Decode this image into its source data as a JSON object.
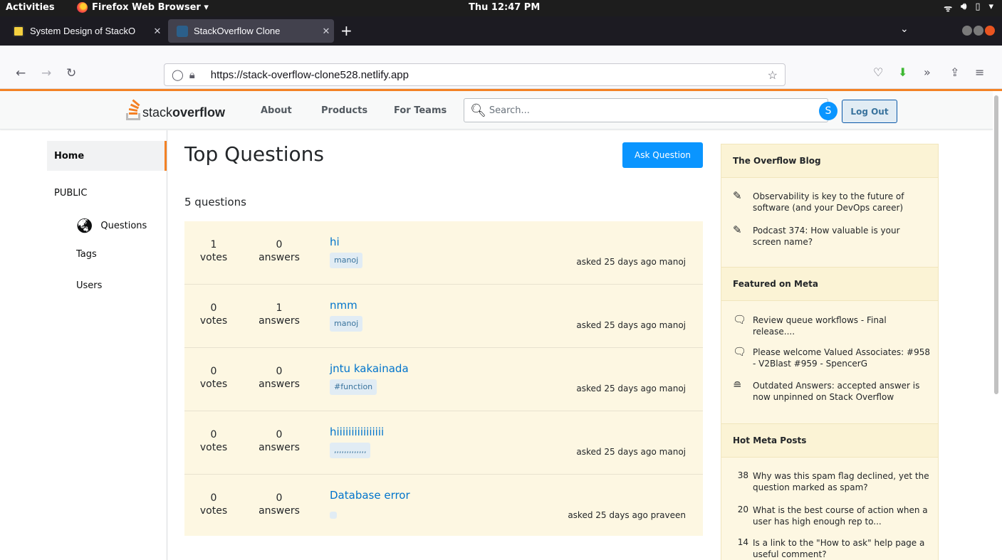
{
  "system": {
    "activities": "Activities",
    "app_menu": "Firefox Web Browser ▾",
    "clock": "Thu 12:47 PM"
  },
  "browser": {
    "tabs": [
      {
        "title": "System Design of StackO",
        "active": false
      },
      {
        "title": "StackOverflow Clone",
        "active": true
      }
    ],
    "url": "https://stack-overflow-clone528.netlify.app"
  },
  "site": {
    "logo_stack": "stack",
    "logo_overflow": "overflow",
    "nav": [
      "About",
      "Products",
      "For Teams"
    ],
    "search_placeholder": "Search...",
    "avatar_letter": "S",
    "logout_label": "Log Out"
  },
  "sidebar": {
    "home": "Home",
    "public": "PUBLIC",
    "questions": "Questions",
    "tags": "Tags",
    "users": "Users"
  },
  "main": {
    "title": "Top Questions",
    "ask_label": "Ask Question",
    "count": "5 questions",
    "questions": [
      {
        "votes": "1",
        "answers": "0",
        "title": "hi",
        "tag": "manoj",
        "meta": "asked 25 days ago manoj"
      },
      {
        "votes": "0",
        "answers": "1",
        "title": "nmm",
        "tag": "manoj",
        "meta": "asked 25 days ago manoj"
      },
      {
        "votes": "0",
        "answers": "0",
        "title": "jntu kakainada",
        "tag": "#function",
        "meta": "asked 25 days ago manoj"
      },
      {
        "votes": "0",
        "answers": "0",
        "title": "hiiiiiiiiiiiiiiii",
        "tag": ",,,,,,,,,,,,,",
        "meta": "asked 25 days ago manoj"
      },
      {
        "votes": "0",
        "answers": "0",
        "title": "Database error",
        "tag": "",
        "meta": "asked 25 days ago praveen"
      }
    ],
    "votes_label": "votes",
    "answers_label": "answers"
  },
  "widget": {
    "blog_title": "The Overflow Blog",
    "blog": [
      "Observability is key to the future of software (and your DevOps career)",
      "Podcast 374: How valuable is your screen name?"
    ],
    "meta_title": "Featured on Meta",
    "meta": [
      "Review queue workflows - Final release....",
      "Please welcome Valued Associates: #958 - V2Blast #959 - SpencerG",
      "Outdated Answers: accepted answer is now unpinned on Stack Overflow"
    ],
    "hot_title": "Hot Meta Posts",
    "hot": [
      {
        "num": "38",
        "text": "Why was this spam flag declined, yet the question marked as spam?"
      },
      {
        "num": "20",
        "text": "What is the best course of action when a user has high enough rep to..."
      },
      {
        "num": "14",
        "text": "Is a link to the \"How to ask\" help page a useful comment?"
      }
    ]
  },
  "colors": {
    "accent": "#f48225",
    "link": "#0074cc",
    "primary_button": "#0a95ff",
    "question_bg": "#fdf7e2"
  }
}
